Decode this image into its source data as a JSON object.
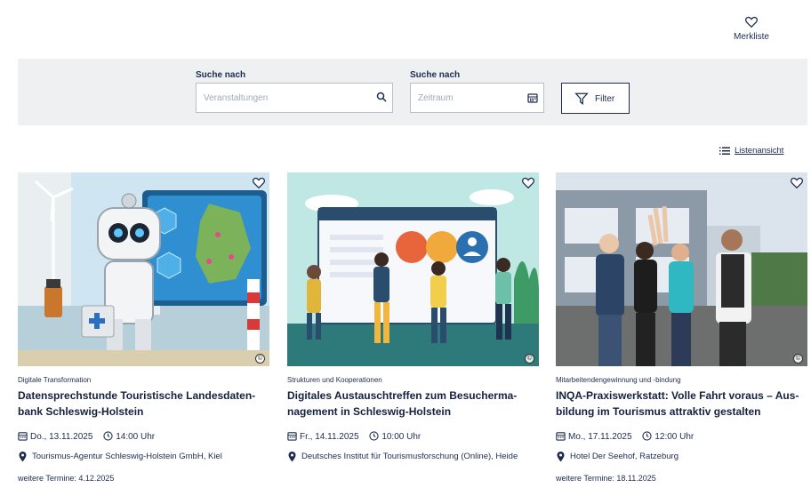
{
  "header": {
    "watchlist_label": "Merkliste"
  },
  "search": {
    "events_label": "Suche nach",
    "events_placeholder": "Veranstaltungen",
    "period_label": "Suche nach",
    "period_placeholder": "Zeitraum",
    "filter_label": "Filter"
  },
  "view": {
    "list_view_label": "Listenansicht"
  },
  "events": [
    {
      "category": "Digitale Transformation",
      "title": "Datensprechstunde Touristische Landesdaten-bank Schleswig-Holstein",
      "date": "Do., 13.11.2025",
      "time": "14:00 Uhr",
      "location": "Tourismus-Agentur Schleswig-Holstein GmbH, Kiel",
      "more_dates": "weitere Termine:  4.12.2025",
      "copyright": "©"
    },
    {
      "category": "Strukturen und Kooperationen",
      "title": "Digitales Austauschtreffen zum Besucherma-nagement in Schleswig-Holstein",
      "date": "Fr., 14.11.2025",
      "time": "10:00 Uhr",
      "location": "Deutsches Institut für Tourismusforschung (Online), Heide",
      "more_dates": "",
      "copyright": "©"
    },
    {
      "category": "Mitarbeitendengewinnung und -bindung",
      "title": "INQA-Praxiswerkstatt: Volle Fahrt voraus – Aus-bildung im Tourismus attraktiv gestalten",
      "date": "Mo., 17.11.2025",
      "time": "12:00 Uhr",
      "location": "Hotel Der Seehof, Ratzeburg",
      "more_dates": "weitere Termine:  18.11.2025",
      "copyright": "©"
    }
  ],
  "icons": {
    "watchlist": "heart-icon",
    "search": "search-icon",
    "calendar": "calendar-icon",
    "filter": "filter-icon",
    "list": "list-icon",
    "clock": "clock-icon",
    "pin": "map-pin-icon"
  },
  "colors": {
    "primary": "#1d2b4f",
    "search_bg": "#eef0f2",
    "border": "#b9bec7"
  }
}
